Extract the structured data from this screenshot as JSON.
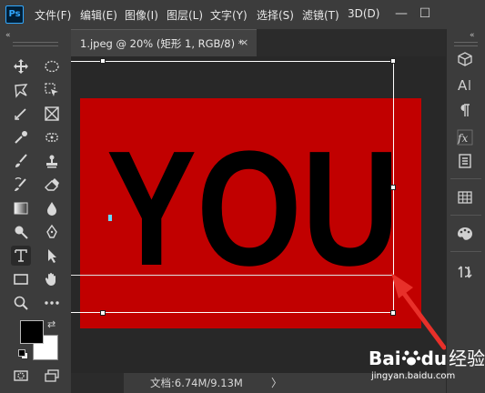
{
  "app": {
    "logo": "Ps"
  },
  "menu": [
    "文件(F)",
    "编辑(E)",
    "图像(I)",
    "图层(L)",
    "文字(Y)",
    "选择(S)",
    "滤镜(T)",
    "3D(D)"
  ],
  "window_controls": {
    "minimize": "—",
    "maximize": "☐"
  },
  "document_tab": {
    "title": "1.jpeg @ 20% (矩形 1, RGB/8) *",
    "close": "×"
  },
  "canvas": {
    "text": "YOU",
    "background_color": "#c10000",
    "text_color": "#000000"
  },
  "status": {
    "doc_info": "文档:6.74M/9.13M",
    "arrow": "〉"
  },
  "colors": {
    "foreground": "#000000",
    "background": "#ffffff",
    "annotation_arrow": "#e8302a",
    "selection": "#ffffff"
  },
  "tools": [
    "move-icon",
    "marquee-ellipse-icon",
    "lasso-icon",
    "object-select-icon",
    "crop-icon",
    "frame-icon",
    "eyedropper-icon",
    "healing-icon",
    "brush-icon",
    "stamp-icon",
    "history-brush-icon",
    "eraser-icon",
    "gradient-icon",
    "blur-icon",
    "dodge-icon",
    "pen-icon",
    "type-icon",
    "path-select-icon",
    "rectangle-icon",
    "hand-icon",
    "zoom-icon",
    "more-icon",
    "quick-mask-icon",
    "screen-mode-icon"
  ],
  "right_panel": [
    "3d-cube-icon",
    "character-icon",
    "paragraph-icon",
    "styles-icon",
    "properties-icon",
    "swatches-grid-icon",
    "palette-icon",
    "adjust-icon"
  ],
  "watermark": {
    "brand": "Bai",
    "brand2": "du",
    "suffix": "经验",
    "url": "jingyan.baidu.com"
  }
}
